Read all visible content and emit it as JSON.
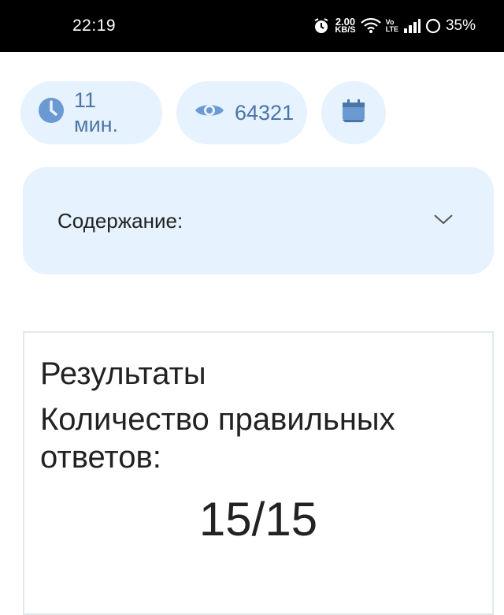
{
  "status_bar": {
    "time": "22:19",
    "speed_value": "2.00",
    "speed_unit": "KB/S",
    "volte_top": "Vo",
    "volte_bottom": "LTE",
    "battery": "35%"
  },
  "meta": {
    "read_time": "11 мин.",
    "views": "64321",
    "icons": [
      "clock-icon",
      "eye-icon",
      "calendar-icon"
    ],
    "pill_color": "#e6f2fd",
    "accent_color": "#4c76a6"
  },
  "toc": {
    "label": "Содержание:"
  },
  "results": {
    "title": "Результаты",
    "correct_label": "Количество правильных ответов:",
    "score": "15/15"
  }
}
